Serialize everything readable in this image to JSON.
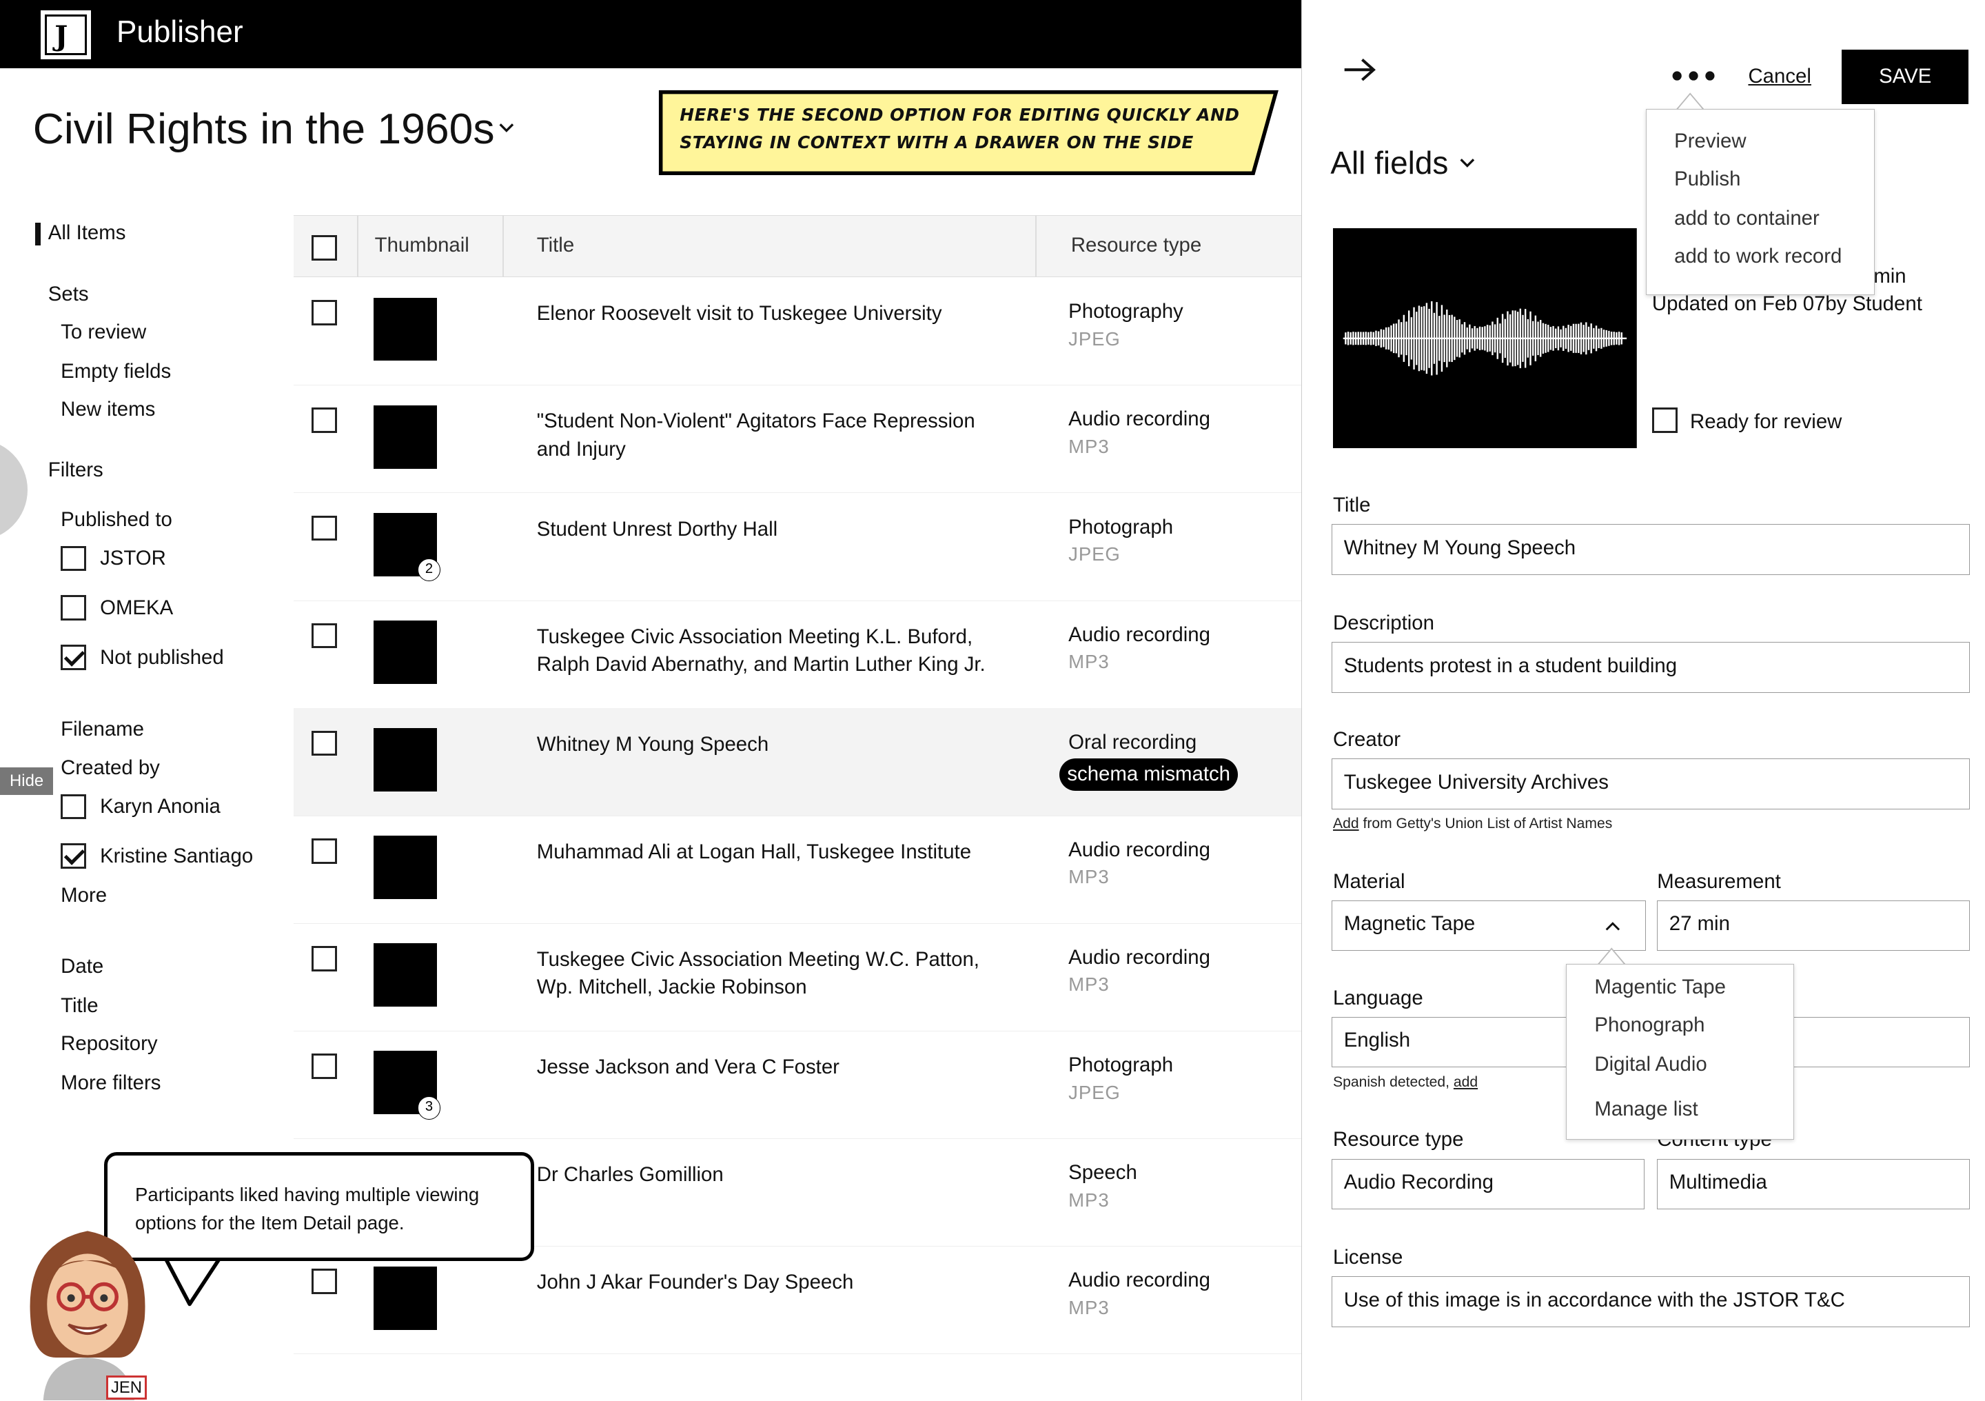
{
  "app": {
    "name": "Publisher"
  },
  "page": {
    "title": "Civil Rights in the 1960s"
  },
  "callout": {
    "text": "Here's the second option for editing quickly and staying in context with a drawer on the side"
  },
  "sidebar": {
    "all_items": "All Items",
    "sets_heading": "Sets",
    "sets": [
      "To review",
      "Empty fields",
      "New items"
    ],
    "filters_heading": "Filters",
    "published_to_heading": "Published to",
    "published_options": [
      {
        "label": "JSTOR",
        "checked": false
      },
      {
        "label": "OMEKA",
        "checked": false
      },
      {
        "label": "Not published",
        "checked": true
      }
    ],
    "filename": "Filename",
    "created_by_heading": "Created by",
    "created_by_options": [
      {
        "label": "Karyn Anonia",
        "checked": false
      },
      {
        "label": "Kristine Santiago",
        "checked": true
      }
    ],
    "more": "More",
    "sort_fields": [
      "Date",
      "Title",
      "Repository"
    ],
    "more_filters": "More filters",
    "hide_label": "Hide"
  },
  "table": {
    "columns": [
      "Thumbnail",
      "Title",
      "Resource type"
    ],
    "rows": [
      {
        "title": "Elenor Roosevelt visit to Tuskegee University",
        "type": "Photography",
        "format": "JPEG"
      },
      {
        "title": "\"Student Non-Violent\" Agitators Face Repression and Injury",
        "type": "Audio recording",
        "format": "MP3"
      },
      {
        "title": "Student Unrest Dorthy Hall",
        "type": "Photograph",
        "format": "JPEG",
        "badge": "2"
      },
      {
        "title": "Tuskegee Civic Association Meeting K.L. Buford, Ralph David Abernathy, and Martin Luther King Jr.",
        "type": "Audio recording",
        "format": "MP3"
      },
      {
        "title": "Whitney M Young Speech",
        "type": "Oral recording",
        "format": "",
        "pill": "schema mismatch",
        "selected": true
      },
      {
        "title": "Muhammad Ali at Logan Hall, Tuskegee Institute",
        "type": "Audio recording",
        "format": "MP3"
      },
      {
        "title": "Tuskegee Civic Association Meeting W.C. Patton, Wp. Mitchell, Jackie Robinson",
        "type": "Audio recording",
        "format": "MP3"
      },
      {
        "title": "Jesse Jackson and Vera C Foster",
        "type": "Photograph",
        "format": "JPEG",
        "badge": "3"
      },
      {
        "title": "Dr Charles Gomillion",
        "type": "Speech",
        "format": "MP3"
      },
      {
        "title": "John J Akar Founder's Day Speech",
        "type": "Audio recording",
        "format": "MP3"
      }
    ]
  },
  "bubble": {
    "text": "Participants liked having multiple viewing options for the Item Detail page.",
    "avatar_label": "JEN"
  },
  "drawer": {
    "arrow_icon": "arrow-right-icon",
    "more_icon": "more-horizontal-icon",
    "cancel": "Cancel",
    "save": "SAVE",
    "view_select": "All fields",
    "menu": [
      "Preview",
      "Publish",
      "add to container",
      "add to work record"
    ],
    "meta_partial": "min",
    "meta_updated": "Updated on Feb 07by Student",
    "ready_label": "Ready for review",
    "fields": {
      "title_label": "Title",
      "title_value": "Whitney M Young Speech",
      "description_label": "Description",
      "description_value": "Students protest in a student building",
      "creator_label": "Creator",
      "creator_value": "Tuskegee University Archives",
      "creator_note_link": "Add",
      "creator_note": " from Getty's Union List of Artist Names",
      "material_label": "Material",
      "material_value": "Magnetic Tape",
      "measurement_label": "Measurement",
      "measurement_value": "27 min",
      "language_label": "Language",
      "language_value": "English",
      "language_note": "Spanish detected, ",
      "language_note_link": "add",
      "resource_type_label": "Resource type",
      "resource_type_value": "Audio Recording",
      "content_type_label": "Content type",
      "content_type_value": "Multimedia",
      "license_label": "License",
      "license_value": "Use of this image is in accordance with the JSTOR T&C"
    },
    "material_options": [
      "Magentic Tape",
      "Phonograph",
      "Digital Audio",
      "Manage list"
    ]
  }
}
